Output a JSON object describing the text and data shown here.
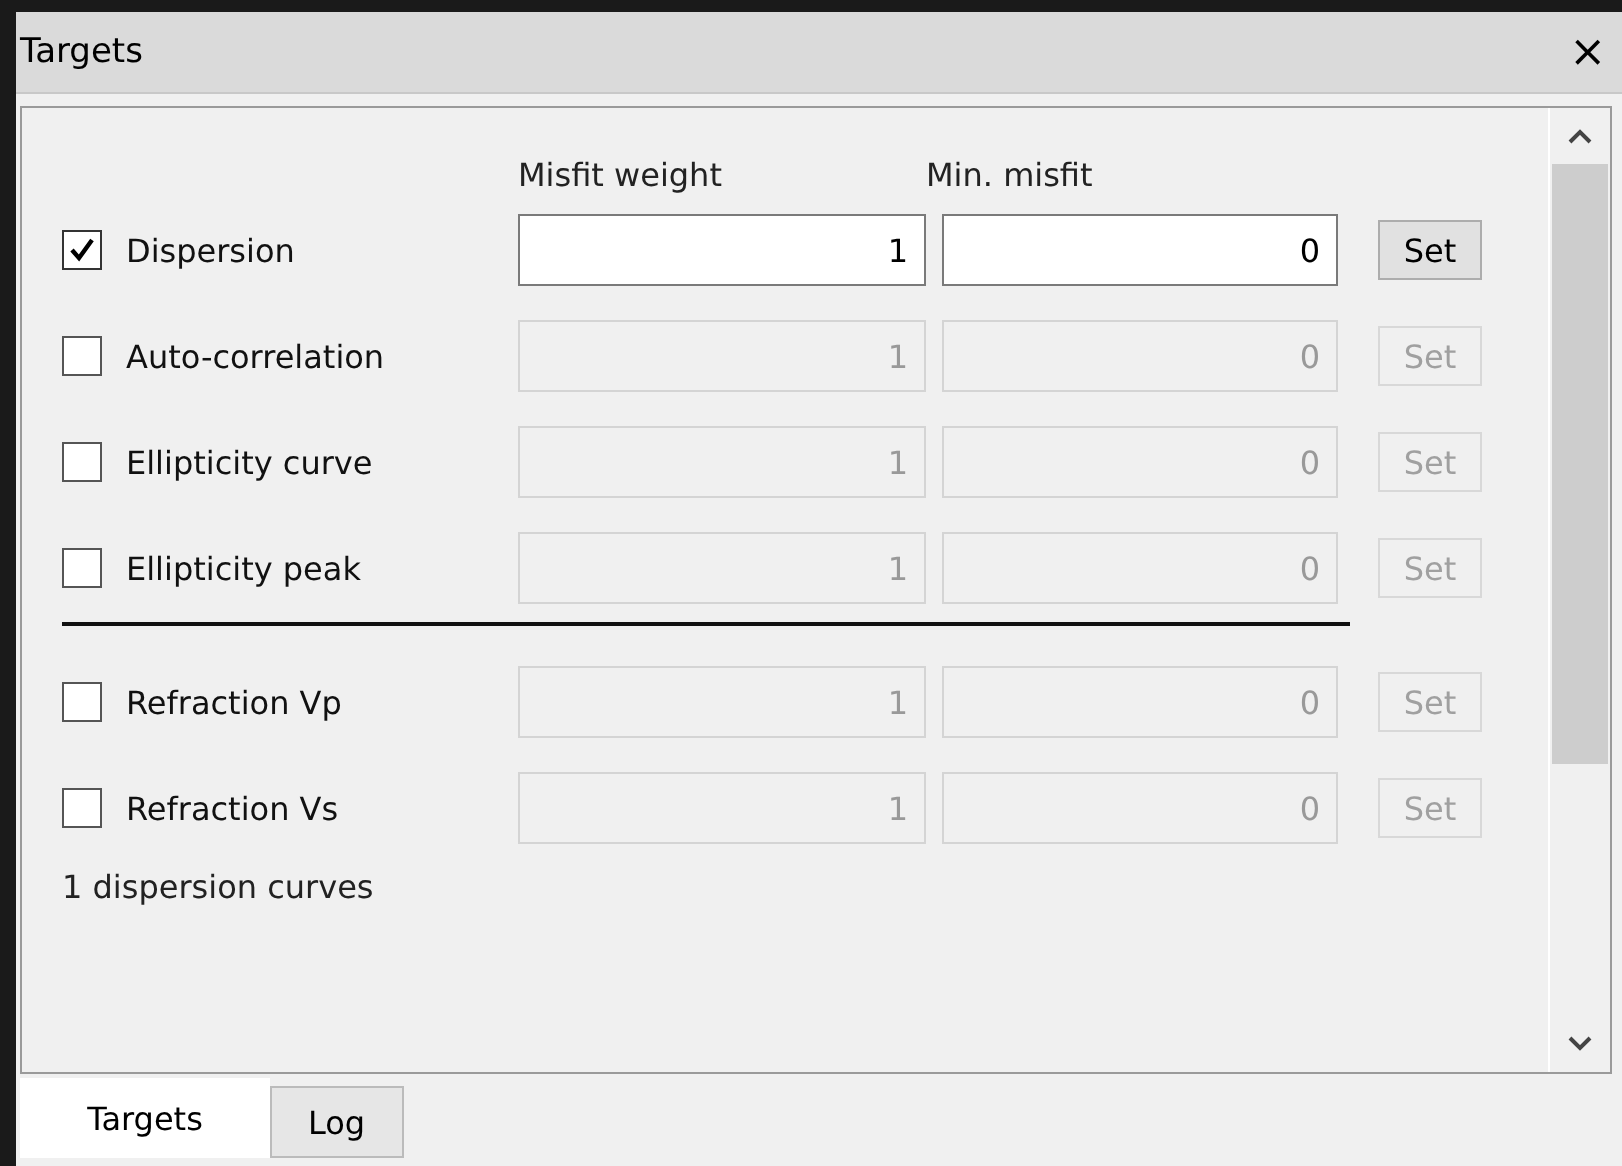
{
  "window": {
    "title": "Targets",
    "close": "×"
  },
  "columns": {
    "weight": "Misfit weight",
    "min": "Min. misfit"
  },
  "groups": [
    [
      {
        "label": "Dispersion",
        "checked": true,
        "weight": "1",
        "min_misfit": "0",
        "button": "Set"
      },
      {
        "label": "Auto-correlation",
        "checked": false,
        "weight": "1",
        "min_misfit": "0",
        "button": "Set"
      },
      {
        "label": "Ellipticity curve",
        "checked": false,
        "weight": "1",
        "min_misfit": "0",
        "button": "Set"
      },
      {
        "label": "Ellipticity peak",
        "checked": false,
        "weight": "1",
        "min_misfit": "0",
        "button": "Set"
      }
    ],
    [
      {
        "label": "Refraction Vp",
        "checked": false,
        "weight": "1",
        "min_misfit": "0",
        "button": "Set"
      },
      {
        "label": "Refraction Vs",
        "checked": false,
        "weight": "1",
        "min_misfit": "0",
        "button": "Set"
      }
    ]
  ],
  "status": "1 dispersion curves",
  "tabs": [
    {
      "label": "Targets",
      "selected": true
    },
    {
      "label": "Log",
      "selected": false
    }
  ]
}
